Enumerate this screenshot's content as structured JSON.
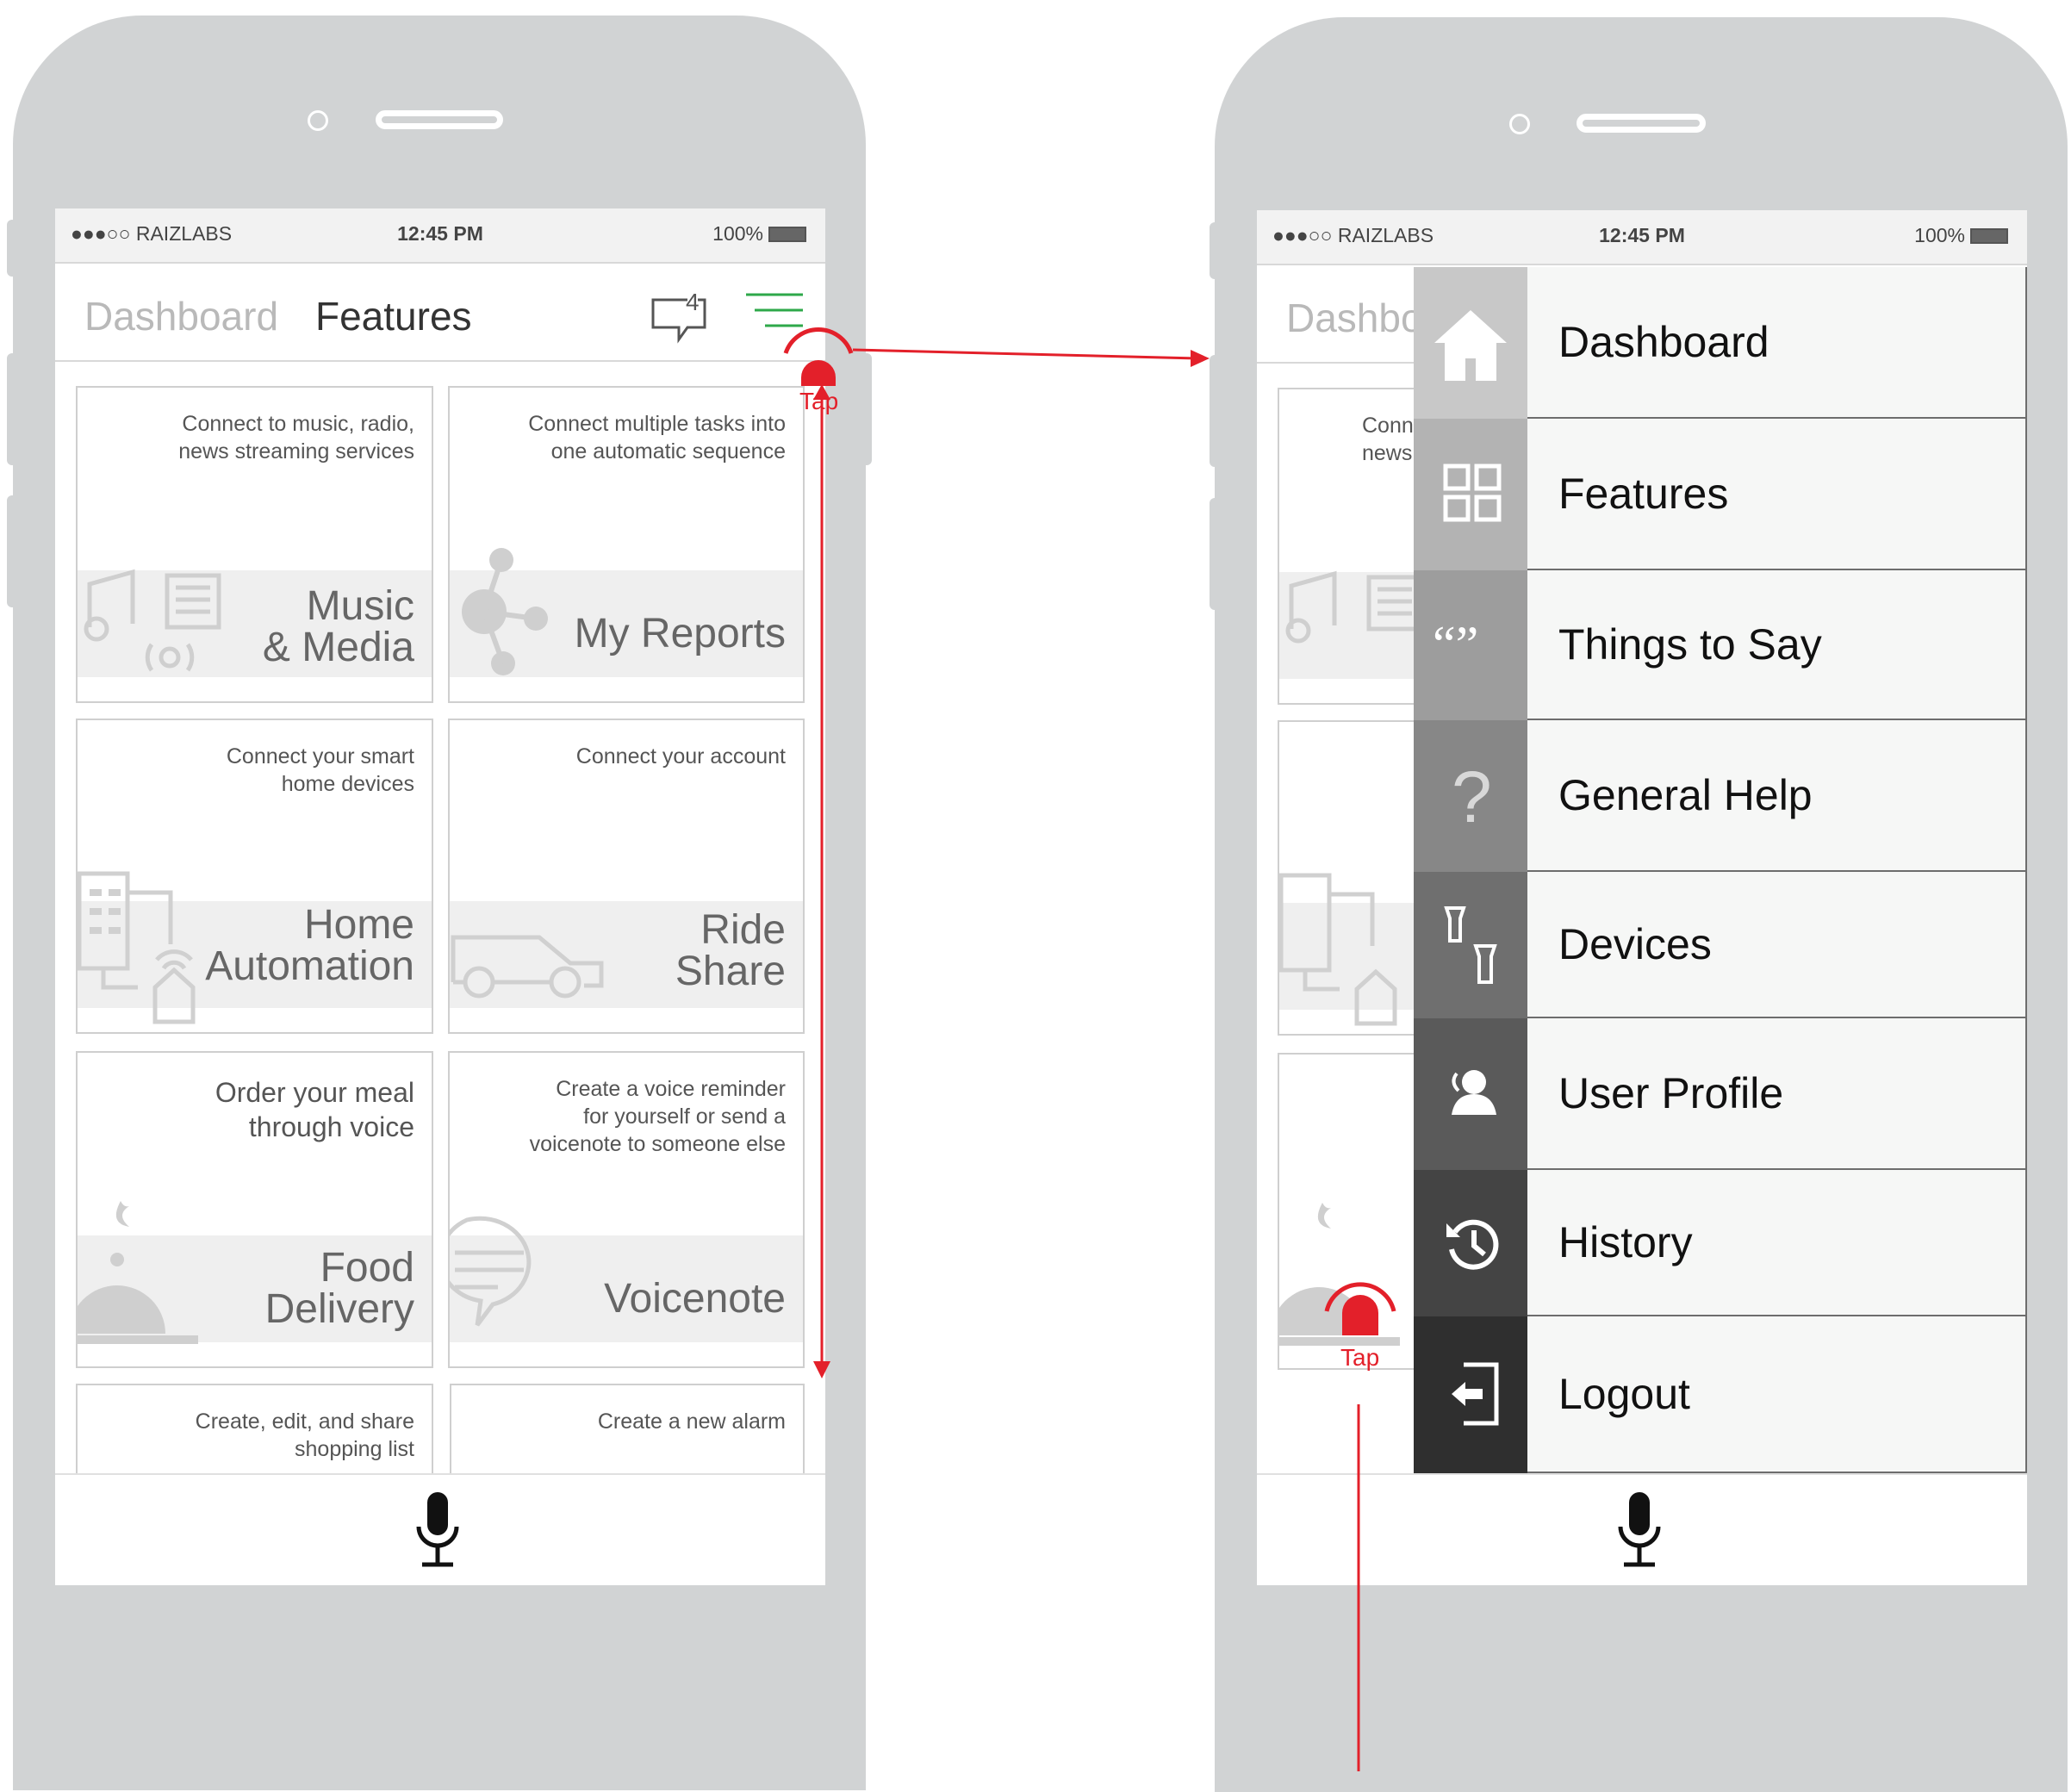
{
  "status_bar": {
    "carrier": "●●●○○ RAIZLABS",
    "time": "12:45 PM",
    "battery": "100%"
  },
  "header": {
    "tab_dashboard": "Dashboard",
    "tab_features": "Features",
    "chat_count": "4"
  },
  "cards": [
    {
      "desc": "Connect to music, radio,\nnews streaming services",
      "title": "Music\n& Media"
    },
    {
      "desc": "Connect multiple tasks into\none automatic sequence",
      "title": "My Reports"
    },
    {
      "desc": "Connect your smart\nhome devices",
      "title": "Home\nAutomation"
    },
    {
      "desc": "Connect your account",
      "title": "Ride\nShare"
    },
    {
      "desc": "Order your meal\nthrough voice",
      "title": "Food\nDelivery"
    },
    {
      "desc": "Create a voice reminder\nfor yourself or send a\nvoicenote to someone else",
      "title": "Voicenote"
    },
    {
      "desc": "Create, edit, and share\nshopping list",
      "title": ""
    },
    {
      "desc": "Create a new alarm",
      "title": ""
    }
  ],
  "right_screen": {
    "header_partial": "Dashbo",
    "card_partial_desc": "Conn\nnews"
  },
  "drawer": {
    "items": [
      {
        "label": "Dashboard",
        "icon": "home-icon",
        "color": "#c8c8c8"
      },
      {
        "label": "Features",
        "icon": "grid-icon",
        "color": "#b3b3b3"
      },
      {
        "label": "Things to Say",
        "icon": "quote-icon",
        "color": "#9d9d9d"
      },
      {
        "label": "General Help",
        "icon": "question-icon",
        "color": "#878787"
      },
      {
        "label": "Devices",
        "icon": "devices-icon",
        "color": "#6f6f6f"
      },
      {
        "label": "User Profile",
        "icon": "user-icon",
        "color": "#5a5a5a"
      },
      {
        "label": "History",
        "icon": "history-icon",
        "color": "#444444"
      },
      {
        "label": "Logout",
        "icon": "logout-icon",
        "color": "#2f2f2f"
      }
    ]
  },
  "annotations": {
    "tap1": "Tap",
    "tap2": "Tap",
    "accent_color": "#e3202a"
  }
}
